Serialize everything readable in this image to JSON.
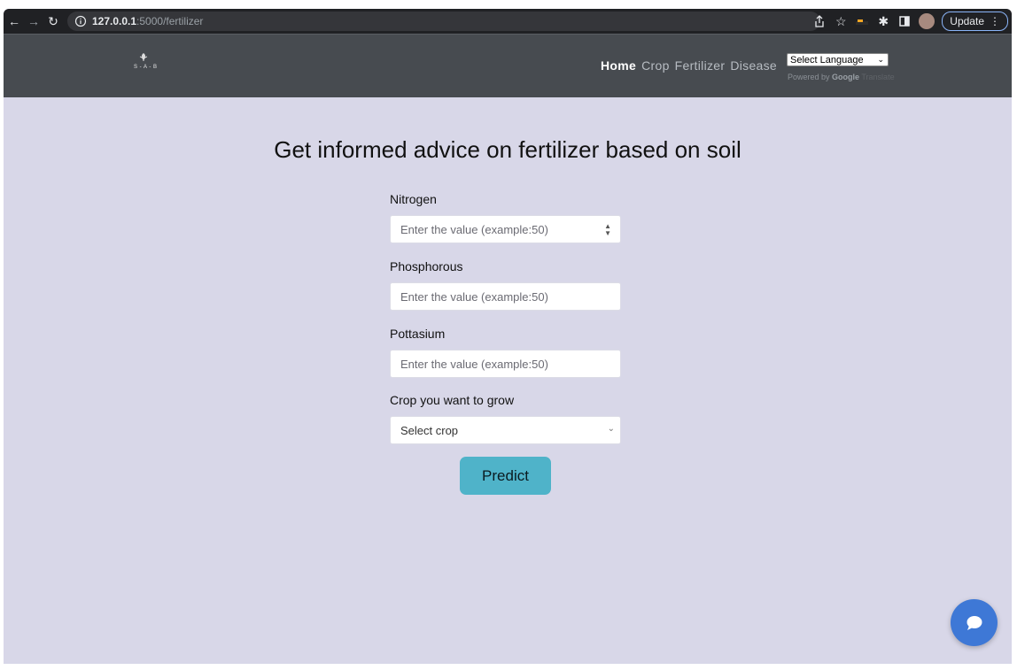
{
  "browser": {
    "url_host": "127.0.0.1",
    "url_path": ":5000/fertilizer",
    "update_label": "Update"
  },
  "navbar": {
    "logo_text": "S - A - B",
    "links": [
      "Home",
      "Crop",
      "Fertilizer",
      "Disease"
    ],
    "active_link": "Home",
    "language_select": "Select Language",
    "powered_by": "Powered by",
    "google": "Google",
    "translate": "Translate"
  },
  "main": {
    "heading": "Get informed advice on fertilizer based on soil",
    "fields": [
      {
        "label": "Nitrogen",
        "placeholder": "Enter the value (example:50)"
      },
      {
        "label": "Phosphorous",
        "placeholder": "Enter the value (example:50)"
      },
      {
        "label": "Pottasium",
        "placeholder": "Enter the value (example:50)"
      }
    ],
    "crop_label": "Crop you want to grow",
    "crop_select": "Select crop",
    "predict_label": "Predict"
  },
  "colors": {
    "page_bg": "#d8d7e8",
    "navbar_bg": "#474b50",
    "predict_bg": "#4fb3c9",
    "chat_bg": "#3e78d6"
  }
}
